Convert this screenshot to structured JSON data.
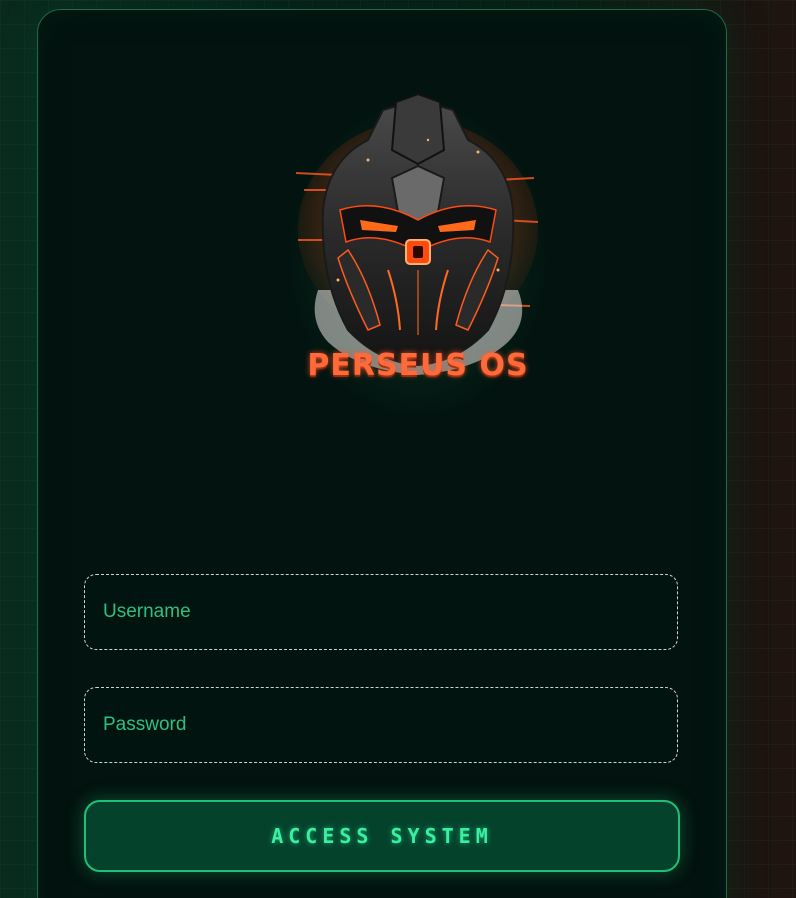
{
  "logo": {
    "text": "PERSEUS OS",
    "icon": "knight-helmet-icon"
  },
  "form": {
    "username_placeholder": "Username",
    "username_value": "",
    "password_placeholder": "Password",
    "password_value": "",
    "submit_label": "ACCESS SYSTEM"
  },
  "colors": {
    "accent": "#2fd18a",
    "button_bg": "#04422c",
    "logo_text": "#ff6a3a",
    "card_bg": "#03130f"
  }
}
